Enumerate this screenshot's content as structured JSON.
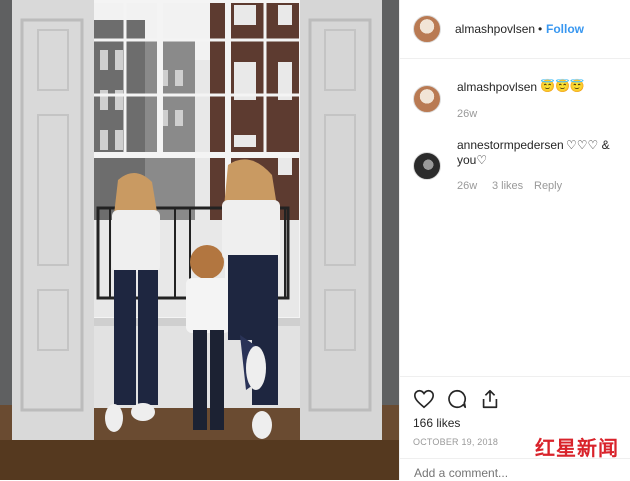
{
  "post": {
    "username": "almashpovlsen",
    "separator": "•",
    "follow_label": "Follow"
  },
  "comments": [
    {
      "username": "almashpovlsen",
      "text": "😇😇😇",
      "age": "26w",
      "likes": "",
      "reply": ""
    },
    {
      "username": "annestormpedersen",
      "text": "♡♡♡ &",
      "text2": "you♡",
      "age": "26w",
      "likes": "3 likes",
      "reply": "Reply"
    }
  ],
  "actions": {
    "like_icon": "heart-icon",
    "comment_icon": "comment-icon",
    "share_icon": "share-icon"
  },
  "stats": {
    "likes": "166 likes",
    "date": "OCTOBER 19, 2018"
  },
  "add_comment": {
    "placeholder": "Add a comment..."
  },
  "watermark": {
    "text": "红星新闻"
  },
  "colors": {
    "link": "#3897f0",
    "text": "#262626",
    "muted": "#999999",
    "watermark": "#d9232b"
  }
}
